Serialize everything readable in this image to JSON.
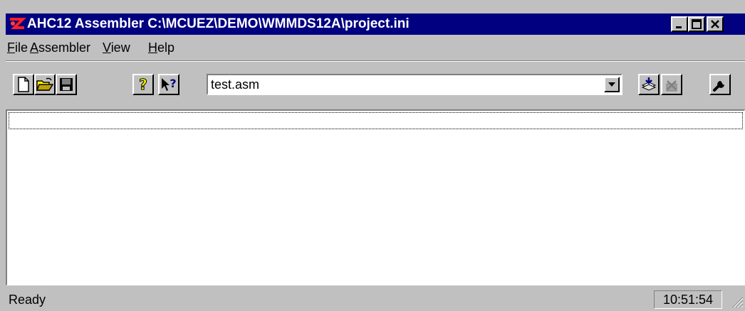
{
  "window": {
    "title": "AHC12 Assembler  C:\\MCUEZ\\DEMO\\WMMDS12A\\project.ini",
    "caption_buttons": [
      "minimize-icon",
      "maximize-icon",
      "close-icon"
    ]
  },
  "menu": {
    "items": [
      {
        "label": "File",
        "accel": "F",
        "rest": "ile"
      },
      {
        "label": "Assembler",
        "accel": "A",
        "rest": "ssembler"
      },
      {
        "label": "View",
        "accel": "V",
        "rest": "iew"
      },
      {
        "label": "Help",
        "accel": "H",
        "rest": "elp"
      }
    ]
  },
  "toolbar": {
    "buttons": [
      "new-file-icon",
      "open-folder-icon",
      "save-disk-icon",
      "help-icon",
      "context-help-icon",
      "assemble-icon",
      "assemble-disabled-icon",
      "options-wrench-icon"
    ],
    "file_combo_value": "test.asm"
  },
  "status": {
    "text": "Ready",
    "time": "10:51:54"
  },
  "colors": {
    "titlebar": "#000080",
    "face": "#c0c0c0",
    "output_bg": "#ffffff"
  }
}
